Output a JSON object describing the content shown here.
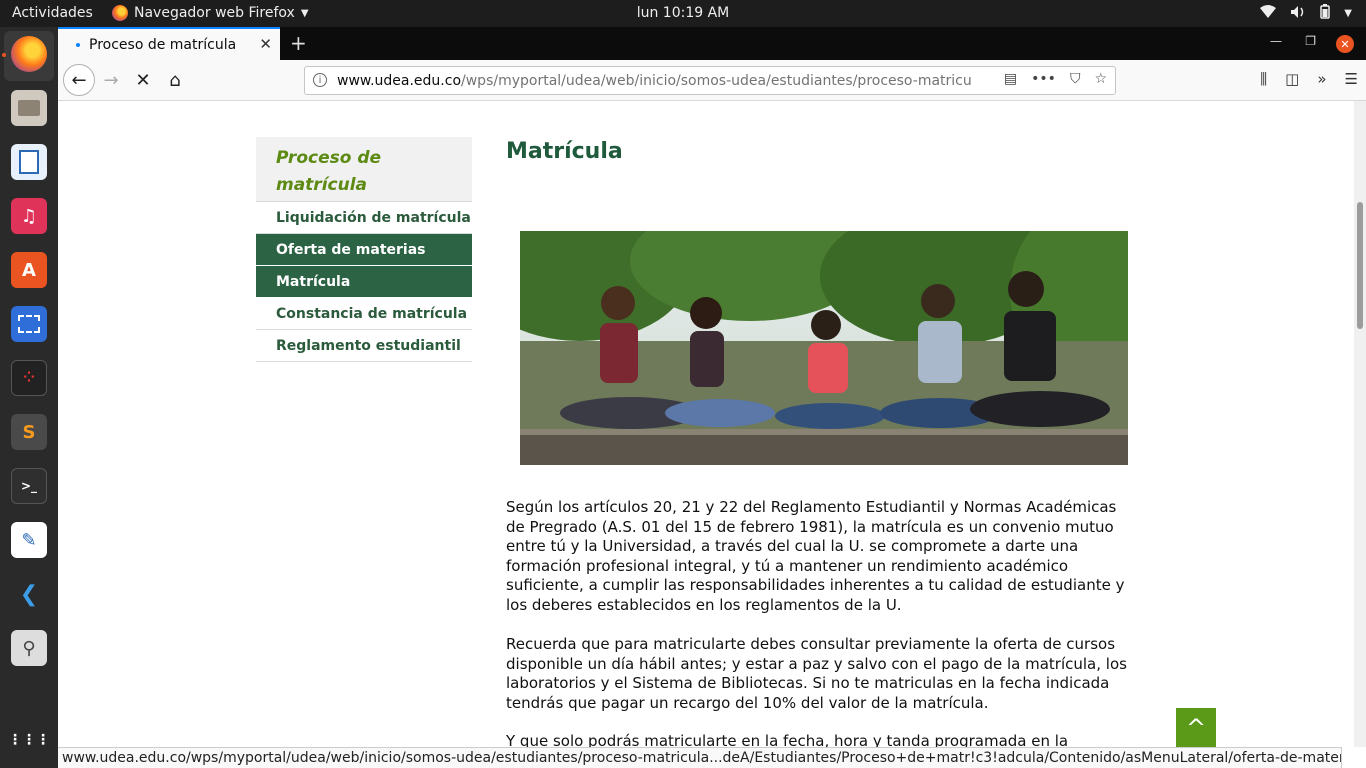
{
  "topbar": {
    "activities": "Actividades",
    "app_menu": "Navegador web Firefox",
    "clock": "lun 10:19 AM"
  },
  "browser": {
    "tab_title": "Proceso de matrícula",
    "url_domain": "www.udea.edu.co",
    "url_path": "/wps/myportal/udea/web/inicio/somos-udea/estudiantes/proceso-matricu",
    "status_url": "www.udea.edu.co/wps/myportal/udea/web/inicio/somos-udea/estudiantes/proceso-matricula...deA/Estudiantes/Proceso+de+matr!c3!adcula/Contenido/asMenuLateral/oferta-de-materias"
  },
  "sidebar": {
    "heading": "Proceso de matrícula",
    "items": [
      {
        "label": "Liquidación de matrícula",
        "active": false
      },
      {
        "label": "Oferta de materias",
        "active": true
      },
      {
        "label": "Matrícula",
        "active": true
      },
      {
        "label": "Constancia de matrícula",
        "active": false
      },
      {
        "label": "Reglamento estudiantil",
        "active": false
      }
    ]
  },
  "main": {
    "title": "Matrícula",
    "paragraphs": [
      "Según los artículos 20, 21 y 22 del Reglamento Estudiantil y Normas Académicas de Pregrado (A.S. 01 del 15 de febrero 1981), la matrícula es un convenio mutuo entre tú y la Universidad, a través del cual la U. se compromete a darte una formación profesional integral, y tú a mantener un rendimiento académico suficiente, a cumplir las responsabilidades inherentes a tu calidad de estudiante y los deberes establecidos en los reglamentos de la U.",
      "Recuerda que para matricularte debes consultar previamente la oferta de cursos disponible un día hábil antes; y estar a paz y salvo con el pago de la matrícula, los laboratorios y el Sistema de Bibliotecas. Si no te matriculas en la fecha indicada tendrás que pagar un recargo del 10% del valor de la matrícula.",
      "Y que solo podrás matricularte en la fecha, hora y tanda programada en la"
    ]
  },
  "colors": {
    "brand_green": "#1e5a3b",
    "menu_active": "#2b6344",
    "heading_italic": "#5c8a13",
    "to_top": "#5b9a18"
  }
}
